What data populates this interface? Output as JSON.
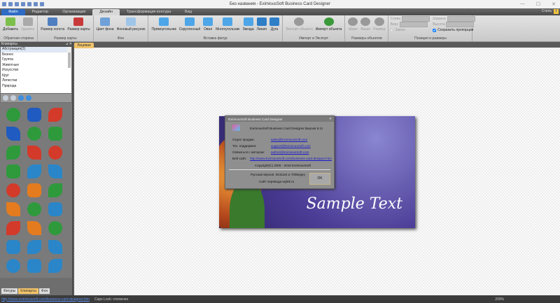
{
  "window": {
    "title": "Без названия - EximiousSoft Business Card Designer",
    "minimize": "—",
    "maximize": "☐",
    "close": "✕"
  },
  "tabs": [
    "Файл",
    "Редактор",
    "Организация",
    "Дизайн",
    "Трансформация контура",
    "Вид"
  ],
  "style_label": "Стиль",
  "info": "i",
  "ribbon": {
    "groups": [
      {
        "label": "Обратная сторона",
        "buttons": [
          {
            "label": "Добавить",
            "color": "#7cbf4b"
          },
          {
            "label": "Удалить",
            "disabled": true,
            "color": "#aaa"
          }
        ]
      },
      {
        "label": "Размер карты",
        "buttons": [
          {
            "label": "Размер холста",
            "color": "#4f7fc0"
          },
          {
            "label": "Размер карты",
            "color": "#c83a3a"
          }
        ]
      },
      {
        "label": "Фон",
        "buttons": [
          {
            "label": "Цвет фона",
            "color": "#6fa0d8"
          },
          {
            "label": "Фоновый рисунок",
            "color": "#9fc6e8"
          }
        ]
      },
      {
        "label": "Вставка фигур",
        "buttons": [
          {
            "label": "Прямоугольник",
            "color": "#4da6e8"
          },
          {
            "label": "Скругленный",
            "color": "#4da6e8"
          },
          {
            "label": "Овал",
            "color": "#4da6e8"
          },
          {
            "label": "Многоугольник",
            "color": "#4da6e8"
          },
          {
            "label": "Звезда",
            "color": "#4da6e8"
          },
          {
            "label": "Линия",
            "color": "#2f7fc8"
          },
          {
            "label": "Дуга",
            "color": "#2f7fc8"
          }
        ]
      },
      {
        "label": "Импорт и Экспорт",
        "buttons": [
          {
            "label": "Экспорт объекта",
            "disabled": true,
            "color": "#999"
          },
          {
            "label": "Импорт объекта",
            "color": "#3a9a3a"
          }
        ]
      },
      {
        "label": "Размеры объектов",
        "buttons": [
          {
            "label": "Шире",
            "disabled": true,
            "color": "#999"
          },
          {
            "label": "Выше",
            "disabled": true,
            "color": "#999"
          },
          {
            "label": "Размер",
            "disabled": true,
            "color": "#999"
          }
        ]
      }
    ],
    "position": {
      "label": "Позиция и размеры",
      "left": "Слева",
      "top": "Верх",
      "lock": "Замок",
      "width": "Ширина",
      "height": "Высота",
      "keep_ratio": "Сохранить пропорции"
    }
  },
  "panel": {
    "title": "Клипарты",
    "pin": "⊿",
    "close": "✕",
    "categories": [
      "Абстракция(2)",
      "Бизнес",
      "Группа",
      "Животные",
      "Искусство",
      "Круг",
      "Лепестки",
      "Природа"
    ],
    "clipart_colors": [
      "#2e9a3c",
      "#1f5bc0",
      "#d33a2a",
      "#1f5bc0",
      "#2e9a3c",
      "#2e9a3c",
      "#2e9a3c",
      "#d33a2a",
      "#d33a2a",
      "#2e9a3c",
      "#2a86c8",
      "#2a86c8",
      "#d33a2a",
      "#e57b1f",
      "#2e9a3c",
      "#e57b1f",
      "#2e9a3c",
      "#2a86c8",
      "#d33a2a",
      "#e57b1f",
      "#2e9a3c",
      "#2a86c8",
      "#2a86c8",
      "#2a86c8",
      "#2a86c8",
      "#2a86c8",
      "#2a86c8"
    ],
    "bottom_tabs": [
      "Фигуры",
      "Клипарты",
      "Фон"
    ]
  },
  "document": {
    "tab": "Лицевая",
    "sample_text": "Sample Text"
  },
  "about": {
    "title": "EximiousSoft Business Card Designer",
    "close": "✕",
    "product": "EximiousSoft Business Card Designer  Версия 5.11",
    "rows": [
      {
        "label": "Отдел продаж:",
        "value": "sales@EximiousSoft.com"
      },
      {
        "label": "Тех. поддержка:",
        "value": "support@EximiousSoft.com"
      },
      {
        "label": "Связаться с автором:",
        "value": "author@EximiousSoft.com"
      },
      {
        "label": "Веб-сайт:",
        "value": "http://www.EximiousSoft.com/business-card-designer.htm"
      }
    ],
    "copyright": "Copyright(C) 2005 - 2018  EximiousSoft",
    "russian": "Русская версия: Dnis124 и 7005egey",
    "site": "Сайт перевода wylek.ru",
    "ok": "OK"
  },
  "status": {
    "link": "http://www.eximioussoft.com/business-card-designer.htm",
    "caps": "Caps Lock: отключен",
    "zoom": "200%"
  }
}
